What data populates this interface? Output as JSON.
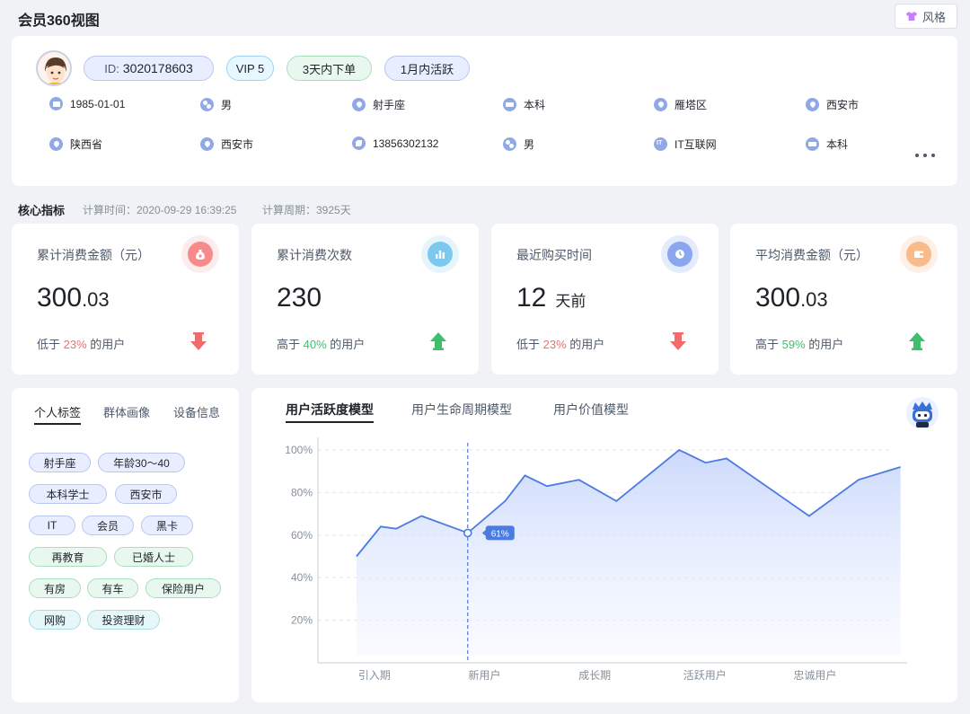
{
  "header": {
    "title": "会员360视图",
    "style_button": "风格"
  },
  "profile": {
    "id_label": "ID:",
    "id_value": "3020178603",
    "badges": [
      "VIP 5",
      "3天内下单",
      "1月内活跃"
    ],
    "info_row1": [
      {
        "icon": "cake-icon",
        "text": "1985-01-01"
      },
      {
        "icon": "gender-icon",
        "text": "男"
      },
      {
        "icon": "pin-icon",
        "text": "射手座"
      },
      {
        "icon": "cap-icon",
        "text": "本科"
      },
      {
        "icon": "pin-icon",
        "text": "雁塔区"
      },
      {
        "icon": "pin-icon",
        "text": "西安市"
      }
    ],
    "info_row2": [
      {
        "icon": "pin-icon",
        "text": "陕西省"
      },
      {
        "icon": "pin-icon",
        "text": "西安市"
      },
      {
        "icon": "phone-icon",
        "text": "13856302132"
      },
      {
        "icon": "gender-icon",
        "text": "男"
      },
      {
        "icon": "it-icon",
        "text": "IT互联网"
      },
      {
        "icon": "cap-icon",
        "text": "本科"
      }
    ]
  },
  "core": {
    "title": "核心指标",
    "time": "计算时间：2020-09-29 16:39:25",
    "period": "计算周期：3925天"
  },
  "metrics": [
    {
      "label": "累计消费金额（元）",
      "int": "300",
      "frac": ".03",
      "unit": "",
      "cmp_pre": "低于 ",
      "pct": "23%",
      "cmp_post": " 的用户",
      "trend": "down",
      "icon": "money-bag-icon",
      "icon_color": "#f78b8b",
      "ring_color": "#fdecec"
    },
    {
      "label": "累计消费次数",
      "int": "230",
      "frac": "",
      "unit": "",
      "cmp_pre": "高于 ",
      "pct": "40%",
      "cmp_post": " 的用户",
      "trend": "up",
      "icon": "bar-chart-icon",
      "icon_color": "#7cc8ee",
      "ring_color": "#e6f5fc"
    },
    {
      "label": "最近购买时间",
      "int": "12",
      "frac": "",
      "unit": "天前",
      "cmp_pre": "低于 ",
      "pct": "23%",
      "cmp_post": " 的用户",
      "trend": "down",
      "icon": "clock-icon",
      "icon_color": "#8aa6ef",
      "ring_color": "#e4ebfc"
    },
    {
      "label": "平均消费金额（元）",
      "int": "300",
      "frac": ".03",
      "unit": "",
      "cmp_pre": "高于 ",
      "pct": "59%",
      "cmp_post": " 的用户",
      "trend": "up",
      "icon": "wallet-icon",
      "icon_color": "#f9bb8a",
      "ring_color": "#fef0e6"
    }
  ],
  "tags_panel": {
    "tabs": [
      "个人标签",
      "群体画像",
      "设备信息"
    ],
    "tags": [
      {
        "text": "射手座",
        "color": "blue"
      },
      {
        "text": "年龄30～40",
        "color": "blue"
      },
      {
        "text": "本科学士",
        "color": "blue"
      },
      {
        "text": "西安市",
        "color": "blue"
      },
      {
        "text": "IT",
        "color": "blue"
      },
      {
        "text": "会员",
        "color": "blue"
      },
      {
        "text": "黑卡",
        "color": "blue"
      },
      {
        "text": "再教育",
        "color": "green"
      },
      {
        "text": "已婚人士",
        "color": "green"
      },
      {
        "text": "有房",
        "color": "green"
      },
      {
        "text": "有车",
        "color": "green"
      },
      {
        "text": "保险用户",
        "color": "green"
      },
      {
        "text": "网购",
        "color": "cyan"
      },
      {
        "text": "投资理财",
        "color": "cyan"
      }
    ]
  },
  "chart_panel": {
    "tabs": [
      "用户活跃度模型",
      "用户生命周期模型",
      "用户价值模型"
    ]
  },
  "chart_data": {
    "type": "area",
    "categories": [
      "引入期",
      "新用户",
      "成长期",
      "活跃用户",
      "忠诚用户"
    ],
    "yticks": [
      "20%",
      "40%",
      "60%",
      "80%",
      "100%"
    ],
    "ylim": [
      0,
      100
    ],
    "x": [
      0,
      0.22,
      0.36,
      0.59,
      1.01,
      1.35,
      1.53,
      1.73,
      2.02,
      2.36,
      2.93,
      3.17,
      3.36,
      4.11,
      4.56,
      4.94
    ],
    "values": [
      50,
      64,
      63,
      69,
      61,
      76,
      88,
      83,
      86,
      76,
      100,
      94,
      96,
      69,
      86,
      92
    ],
    "highlight": {
      "x": 1.01,
      "value": 61,
      "label": "61%"
    },
    "grid": true,
    "line_color": "#4a7be0"
  }
}
